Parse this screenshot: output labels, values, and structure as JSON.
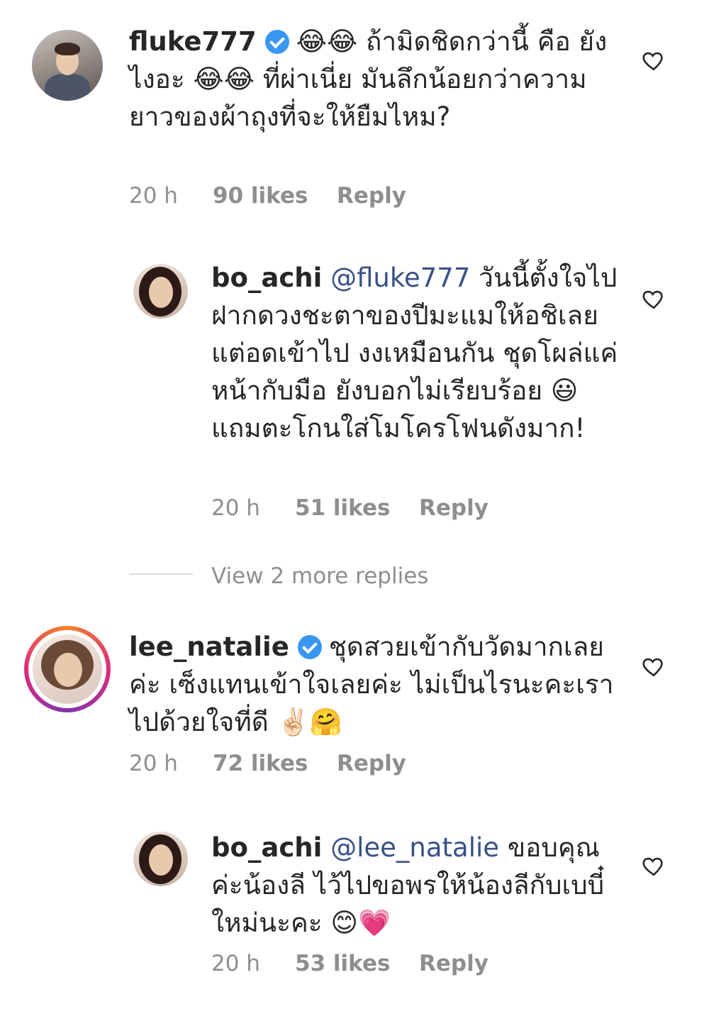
{
  "comments": [
    {
      "username": "fluke777",
      "verified": true,
      "text": "😂😂 ถ้ามิดชิดกว่านี้ คือ ยังไงอะ 😂😂 ที่ผ่าเนี่ย มันลึกน้อยกว่าความยาวของผ้าถุงที่จะให้ยืมไหม?",
      "time": "20 h",
      "likes": "90 likes",
      "reply": "Reply"
    },
    {
      "username": "bo_achi",
      "mention": "@fluke777",
      "text": "วันนี้ตั้งใจไปฝากดวงชะตาของปีมะแมให้อชิเลย แต่อดเข้าไป งงเหมือนกัน ชุดโผล่แค่หน้ากับมือ ยังบอกไม่เรียบร้อย 😃 แถมตะโกนใส่โมโครโฟนดังมาก!",
      "time": "20 h",
      "likes": "51 likes",
      "reply": "Reply"
    },
    {
      "username": "lee_natalie",
      "verified": true,
      "text": "ชุดสวยเข้ากับวัดมากเลยค่ะ เซ็งแทนเข้าใจเลยค่ะ ไม่เป็นไรนะคะเราไปด้วยใจที่ดี ✌🏻🤗",
      "time": "20 h",
      "likes": "72 likes",
      "reply": "Reply"
    },
    {
      "username": "bo_achi",
      "mention": "@lee_natalie",
      "text": "ขอบคุณค่ะน้องลี ไว้ไปขอพรให้น้องลีกับเบบี๋ใหม่นะคะ 😊💗",
      "time": "20 h",
      "likes": "53 likes",
      "reply": "Reply"
    }
  ],
  "view_more": "View 2 more replies",
  "icons": {
    "like": "heart-outline-icon",
    "verified": "verified-badge-icon"
  },
  "colors": {
    "verified": "#3897f0",
    "mention": "#385185",
    "muted": "#8e8e8e"
  }
}
